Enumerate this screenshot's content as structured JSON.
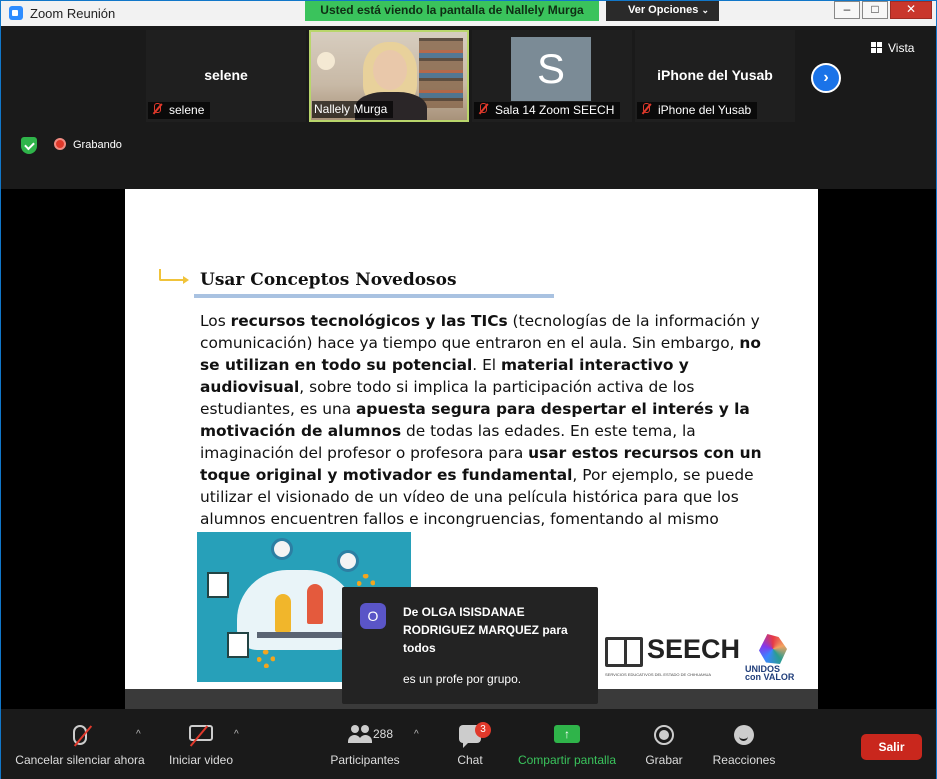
{
  "window": {
    "title": "Zoom Reunión",
    "banner": "Usted está viendo la pantalla de Nallely Murga",
    "view_options": "Ver Opciones",
    "view_mode": "Vista"
  },
  "participants": [
    {
      "display_name": "selene",
      "label": "selene",
      "muted": true
    },
    {
      "display_name": "",
      "label": "Nallely Murga",
      "muted": false,
      "video": true
    },
    {
      "display_name": "",
      "avatar_letter": "S",
      "label": "Sala 14 Zoom SEECH",
      "muted": true
    },
    {
      "display_name": "iPhone del Yusab",
      "label": "iPhone del Yusab",
      "muted": true
    }
  ],
  "status": {
    "recording": "Grabando"
  },
  "slide": {
    "heading": "Usar Conceptos Novedosos",
    "paragraph": [
      {
        "t": "Los ",
        "b": false
      },
      {
        "t": "recursos tecnológicos y las TICs",
        "b": true
      },
      {
        "t": " (tecnologías de la información y comunicación) hace ya tiempo que entraron en el aula. Sin embargo, ",
        "b": false
      },
      {
        "t": "no se utilizan en todo su potencial",
        "b": true
      },
      {
        "t": ". El ",
        "b": false
      },
      {
        "t": "material interactivo y audiovisual",
        "b": true
      },
      {
        "t": ", sobre todo si implica la participación activa de los estudiantes, es una ",
        "b": false
      },
      {
        "t": "apuesta segura para despertar el interés y la motivación de alumnos",
        "b": true
      },
      {
        "t": " de todas las edades. En este tema, la imaginación del profesor o profesora para ",
        "b": false
      },
      {
        "t": "usar estos recursos con un toque original y motivador es fundamental",
        "b": true
      },
      {
        "t": ", Por ejemplo, se puede utilizar el visionado de un vídeo de una película histórica para que los alumnos encuentren fallos e incongruencias, fomentando al mismo tiempo su espíritu crítico.",
        "b": false
      }
    ],
    "logo_seech": "SEECH",
    "logo_seech_sub": "SERVICIOS EDUCATIVOS DEL ESTADO DE CHIHUAHUA",
    "logo_unidos_1": "UNIDOS",
    "logo_unidos_2": "con VALOR"
  },
  "chat_toast": {
    "avatar_letter": "O",
    "from": "De OLGA ISISDANAE RODRIGUEZ MARQUEZ para todos",
    "message": "es un profe por grupo."
  },
  "toolbar": {
    "mute_label": "Cancelar silenciar ahora",
    "video_label": "Iniciar video",
    "participants_label": "Participantes",
    "participants_count": "288",
    "chat_label": "Chat",
    "chat_badge": "3",
    "share_label": "Compartir pantalla",
    "record_label": "Grabar",
    "reactions_label": "Reacciones",
    "leave_label": "Salir"
  },
  "colors": {
    "banner": "#3ac35c",
    "leave": "#c9271d",
    "share": "#2fb44a",
    "accent_blue": "#1a73e8"
  }
}
